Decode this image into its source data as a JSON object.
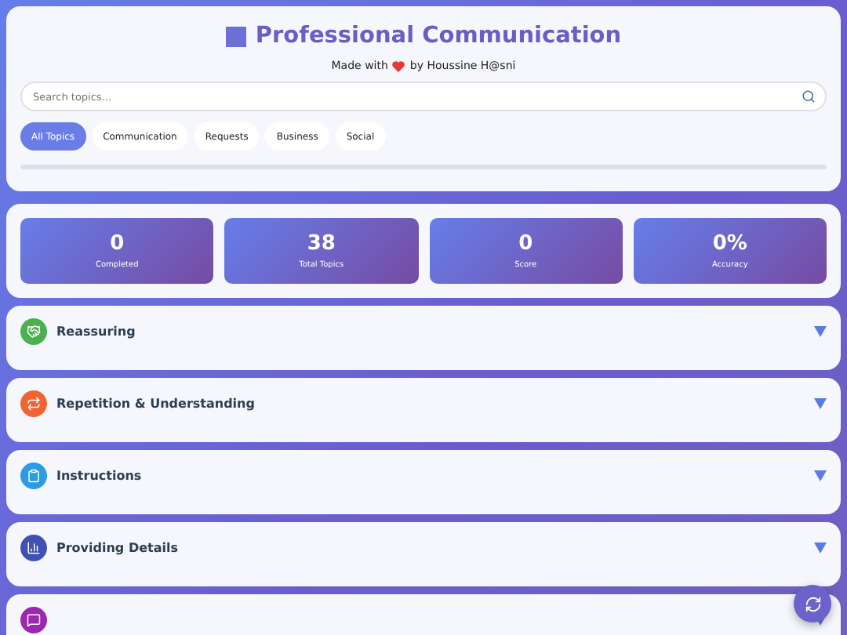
{
  "header": {
    "title": "Professional Communication",
    "subtitle_before": "Made with",
    "subtitle_after": "by Houssine H@sni"
  },
  "search": {
    "placeholder": "Search topics..."
  },
  "filters": [
    {
      "label": "All Topics",
      "selected": true
    },
    {
      "label": "Communication",
      "selected": false
    },
    {
      "label": "Requests",
      "selected": false
    },
    {
      "label": "Business",
      "selected": false
    },
    {
      "label": "Social",
      "selected": false
    }
  ],
  "progress": {
    "level": 0
  },
  "stats": [
    {
      "value": "0",
      "label": "Completed"
    },
    {
      "value": "38",
      "label": "Total Topics"
    },
    {
      "value": "0",
      "label": "Score"
    },
    {
      "value": "0%",
      "label": "Accuracy"
    }
  ],
  "topics": [
    {
      "title": "Reassuring",
      "kind": "handshake",
      "color": "#4caf50",
      "expanded": false
    },
    {
      "title": "Repetition & Understanding",
      "kind": "repeat",
      "color": "#f06432",
      "expanded": false
    },
    {
      "title": "Instructions",
      "kind": "clipboard",
      "color": "#2b9be6",
      "expanded": false
    },
    {
      "title": "Providing Details",
      "kind": "chart",
      "color": "#3f51b5",
      "expanded": false
    },
    {
      "kind": "chat",
      "color": "#9c27b0",
      "expanded": false
    }
  ]
}
